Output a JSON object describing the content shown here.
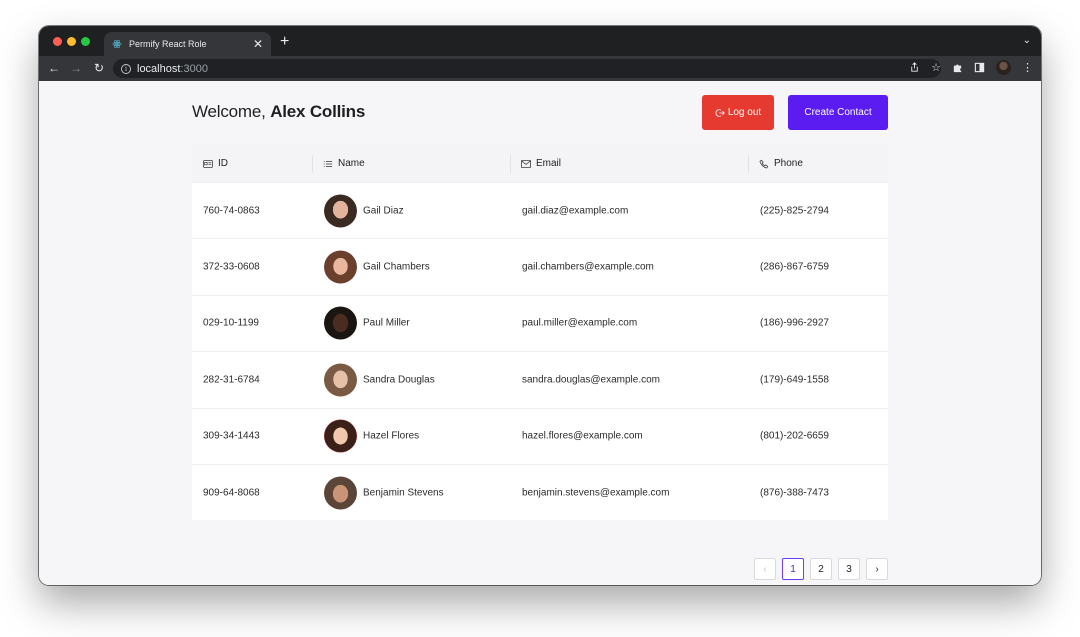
{
  "browser": {
    "tab_title": "Permify React Role",
    "url_host": "localhost",
    "url_port": ":3000"
  },
  "header": {
    "welcome_prefix": "Welcome,",
    "user_name": "Alex Collins",
    "logout_label": "Log out",
    "create_label": "Create Contact"
  },
  "table": {
    "columns": [
      {
        "label": "ID",
        "icon": "id-card-icon"
      },
      {
        "label": "Name",
        "icon": "list-icon"
      },
      {
        "label": "Email",
        "icon": "mail-icon"
      },
      {
        "label": "Phone",
        "icon": "phone-icon"
      }
    ],
    "rows": [
      {
        "id": "760-74-0863",
        "name": "Gail Diaz",
        "email": "gail.diaz@example.com",
        "phone": "(225)-825-2794"
      },
      {
        "id": "372-33-0608",
        "name": "Gail Chambers",
        "email": "gail.chambers@example.com",
        "phone": "(286)-867-6759"
      },
      {
        "id": "029-10-1199",
        "name": "Paul Miller",
        "email": "paul.miller@example.com",
        "phone": "(186)-996-2927"
      },
      {
        "id": "282-31-6784",
        "name": "Sandra Douglas",
        "email": "sandra.douglas@example.com",
        "phone": "(179)-649-1558"
      },
      {
        "id": "309-34-1443",
        "name": "Hazel Flores",
        "email": "hazel.flores@example.com",
        "phone": "(801)-202-6659"
      },
      {
        "id": "909-64-8068",
        "name": "Benjamin Stevens",
        "email": "benjamin.stevens@example.com",
        "phone": "(876)-388-7473"
      }
    ]
  },
  "pagination": {
    "prev": "‹",
    "pages": [
      "1",
      "2",
      "3"
    ],
    "current": "1",
    "next": "›"
  },
  "colors": {
    "logout": "#e6392f",
    "create": "#5b1cf2"
  }
}
